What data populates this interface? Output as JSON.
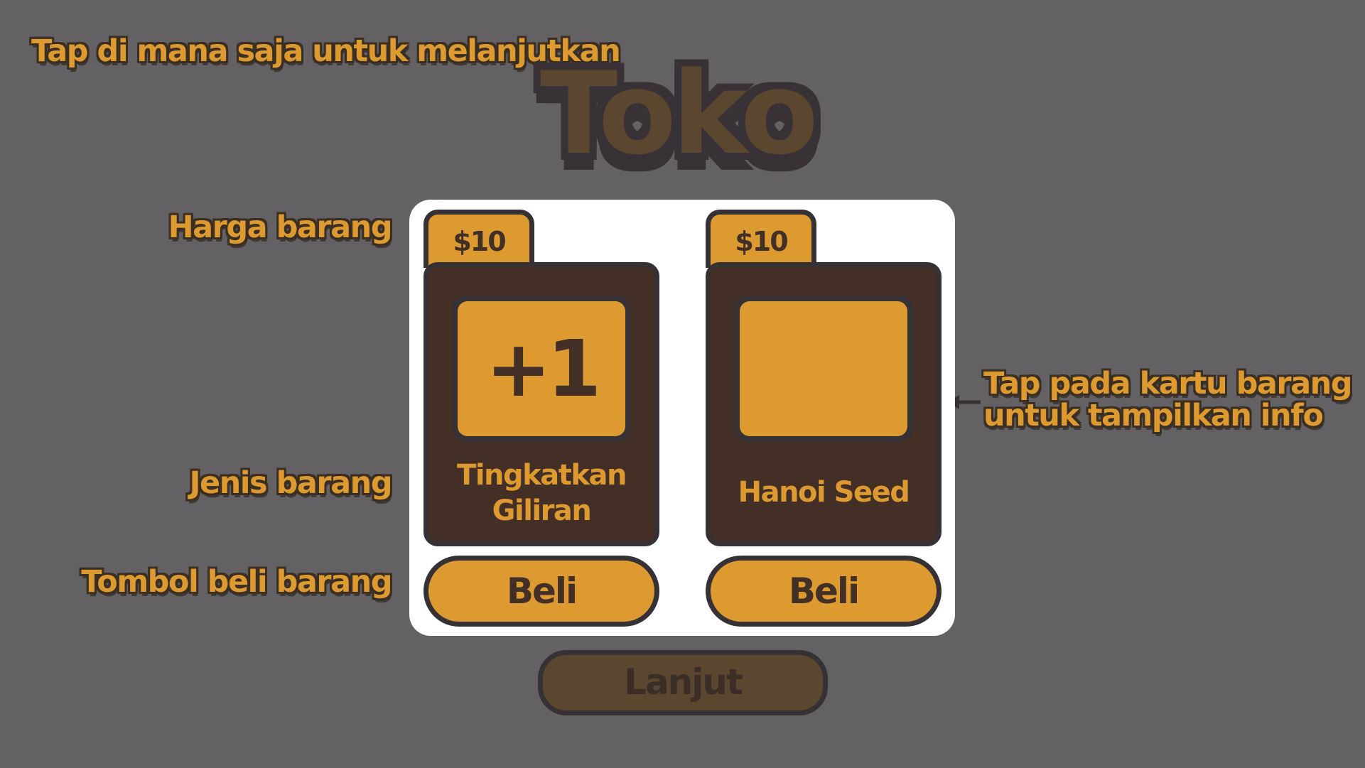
{
  "overlay": {
    "tap_anywhere": "Tap di mana saja untuk melanjutkan",
    "label_price": "Harga barang",
    "label_type": "Jenis barang",
    "label_buy": "Tombol beli barang",
    "label_card_info_line1": "Tap pada kartu barang",
    "label_card_info_line2": "untuk tampilkan info",
    "arrow_icon": "arrow-left-icon"
  },
  "shop": {
    "title": "Toko",
    "items": [
      {
        "price": "$10",
        "icon_text": "+1",
        "name_line1": "Tingkatkan",
        "name_line2": "Giliran",
        "buy_label": "Beli"
      },
      {
        "price": "$10",
        "icon_text": "",
        "name_line1": "Hanoi Seed",
        "name_line2": "",
        "buy_label": "Beli"
      }
    ],
    "continue_label": "Lanjut"
  },
  "colors": {
    "background": "#636163",
    "accent": "#DD9A31",
    "card": "#432F25",
    "outline": "#363135",
    "continue_button": "#5b4630"
  }
}
